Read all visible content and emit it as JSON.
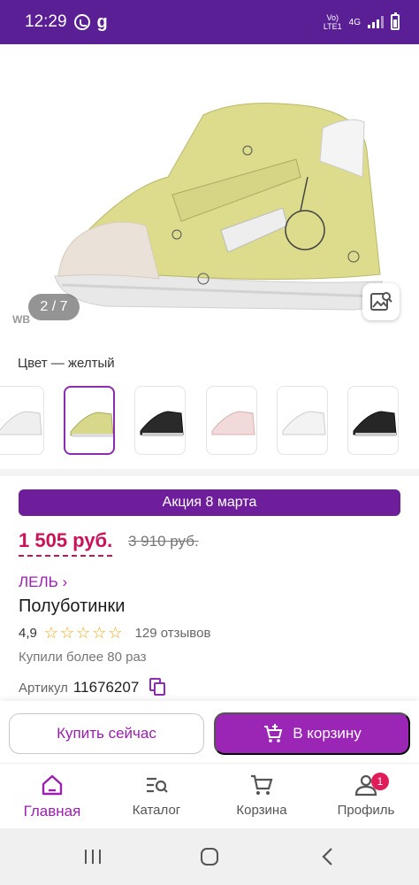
{
  "status_bar": {
    "time": "12:29",
    "network_top": "Vo)",
    "network_bottom": "LTE1",
    "network_type": "4G",
    "icons": [
      "whatsapp-icon",
      "g-icon",
      "signal-icon",
      "battery-icon"
    ]
  },
  "gallery": {
    "counter": "2 / 7",
    "watermark": "WB",
    "product_color": "#d8d88a"
  },
  "color": {
    "label": "Цвет — желтый",
    "variants": [
      {
        "name": "white",
        "color": "#efefef"
      },
      {
        "name": "yellow",
        "color": "#d8d88a",
        "selected": true
      },
      {
        "name": "black",
        "color": "#2a2a2a"
      },
      {
        "name": "white-pink",
        "color": "#f2dada"
      },
      {
        "name": "white-silver",
        "color": "#f3f3f3"
      },
      {
        "name": "black-silver",
        "color": "#262626"
      }
    ]
  },
  "promo": {
    "label": "Акция 8 марта"
  },
  "price": {
    "current": "1 505 руб.",
    "old": "3 910 руб."
  },
  "product": {
    "brand": "ЛЕЛЬ ›",
    "title": "Полуботинки",
    "rating": "4,9",
    "stars": 5,
    "reviews": "129 отзывов",
    "bought": "Купили более 80 раз",
    "article_label": "Артикул",
    "article_value": "11676207"
  },
  "actions": {
    "buy_now": "Купить сейчас",
    "add_to_cart": "В корзину"
  },
  "nav": {
    "items": [
      {
        "label": "Главная",
        "icon": "home-icon",
        "active": true
      },
      {
        "label": "Каталог",
        "icon": "catalog-icon"
      },
      {
        "label": "Корзина",
        "icon": "cart-icon"
      },
      {
        "label": "Профиль",
        "icon": "profile-icon",
        "badge": "1"
      }
    ]
  },
  "colors": {
    "accent": "#9b26b6",
    "price": "#cb1158",
    "status_bar": "#5a1f94",
    "promo": "#6e1e9a"
  }
}
